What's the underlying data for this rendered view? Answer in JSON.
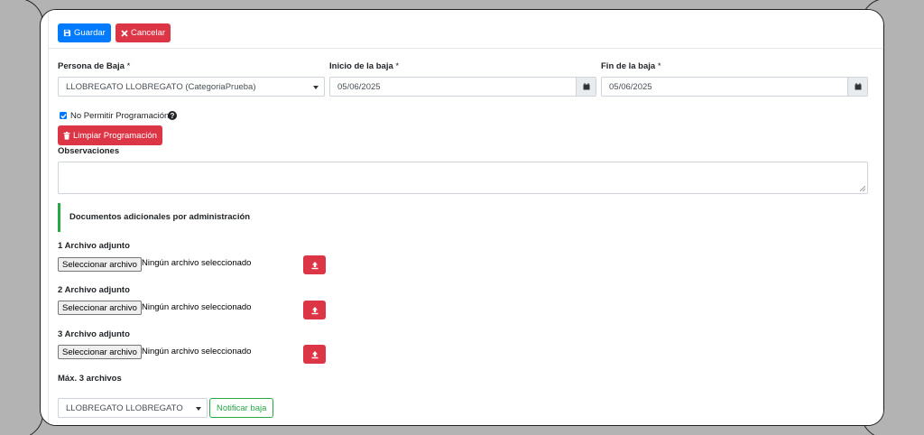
{
  "toolbar": {
    "save_label": "Guardar",
    "cancel_label": "Cancelar"
  },
  "form": {
    "person": {
      "label": "Persona de Baja",
      "required_mark": "*",
      "value": "LLOBREGATO LLOBREGATO (CategoriaPrueba)"
    },
    "start": {
      "label": "Inicio de la baja",
      "required_mark": "*",
      "value": "05/06/2025"
    },
    "end": {
      "label": "Fin de la baja",
      "required_mark": "*",
      "value": "05/06/2025"
    },
    "no_schedule": {
      "label": "No Permitir Programación",
      "checked": true
    },
    "clear_label": "Limpiar Programación",
    "observations": {
      "label": "Observaciones",
      "value": ""
    }
  },
  "documents": {
    "section_title": "Documentos adicionales por administración",
    "attachments": [
      {
        "label": "1 Archivo adjunto",
        "button": "Seleccionar archivo",
        "status": "Ningún archivo seleccionado"
      },
      {
        "label": "2 Archivo adjunto",
        "button": "Seleccionar archivo",
        "status": "Ningún archivo seleccionado"
      },
      {
        "label": "3 Archivo adjunto",
        "button": "Seleccionar archivo",
        "status": "Ningún archivo seleccionado"
      }
    ],
    "max_note": "Máx. 3 archivos"
  },
  "notify": {
    "recipient": "LLOBREGATO LLOBREGATO",
    "button_label": "Notificar baja"
  },
  "colors": {
    "primary": "#007bff",
    "danger": "#dc3545",
    "success": "#28a745"
  }
}
